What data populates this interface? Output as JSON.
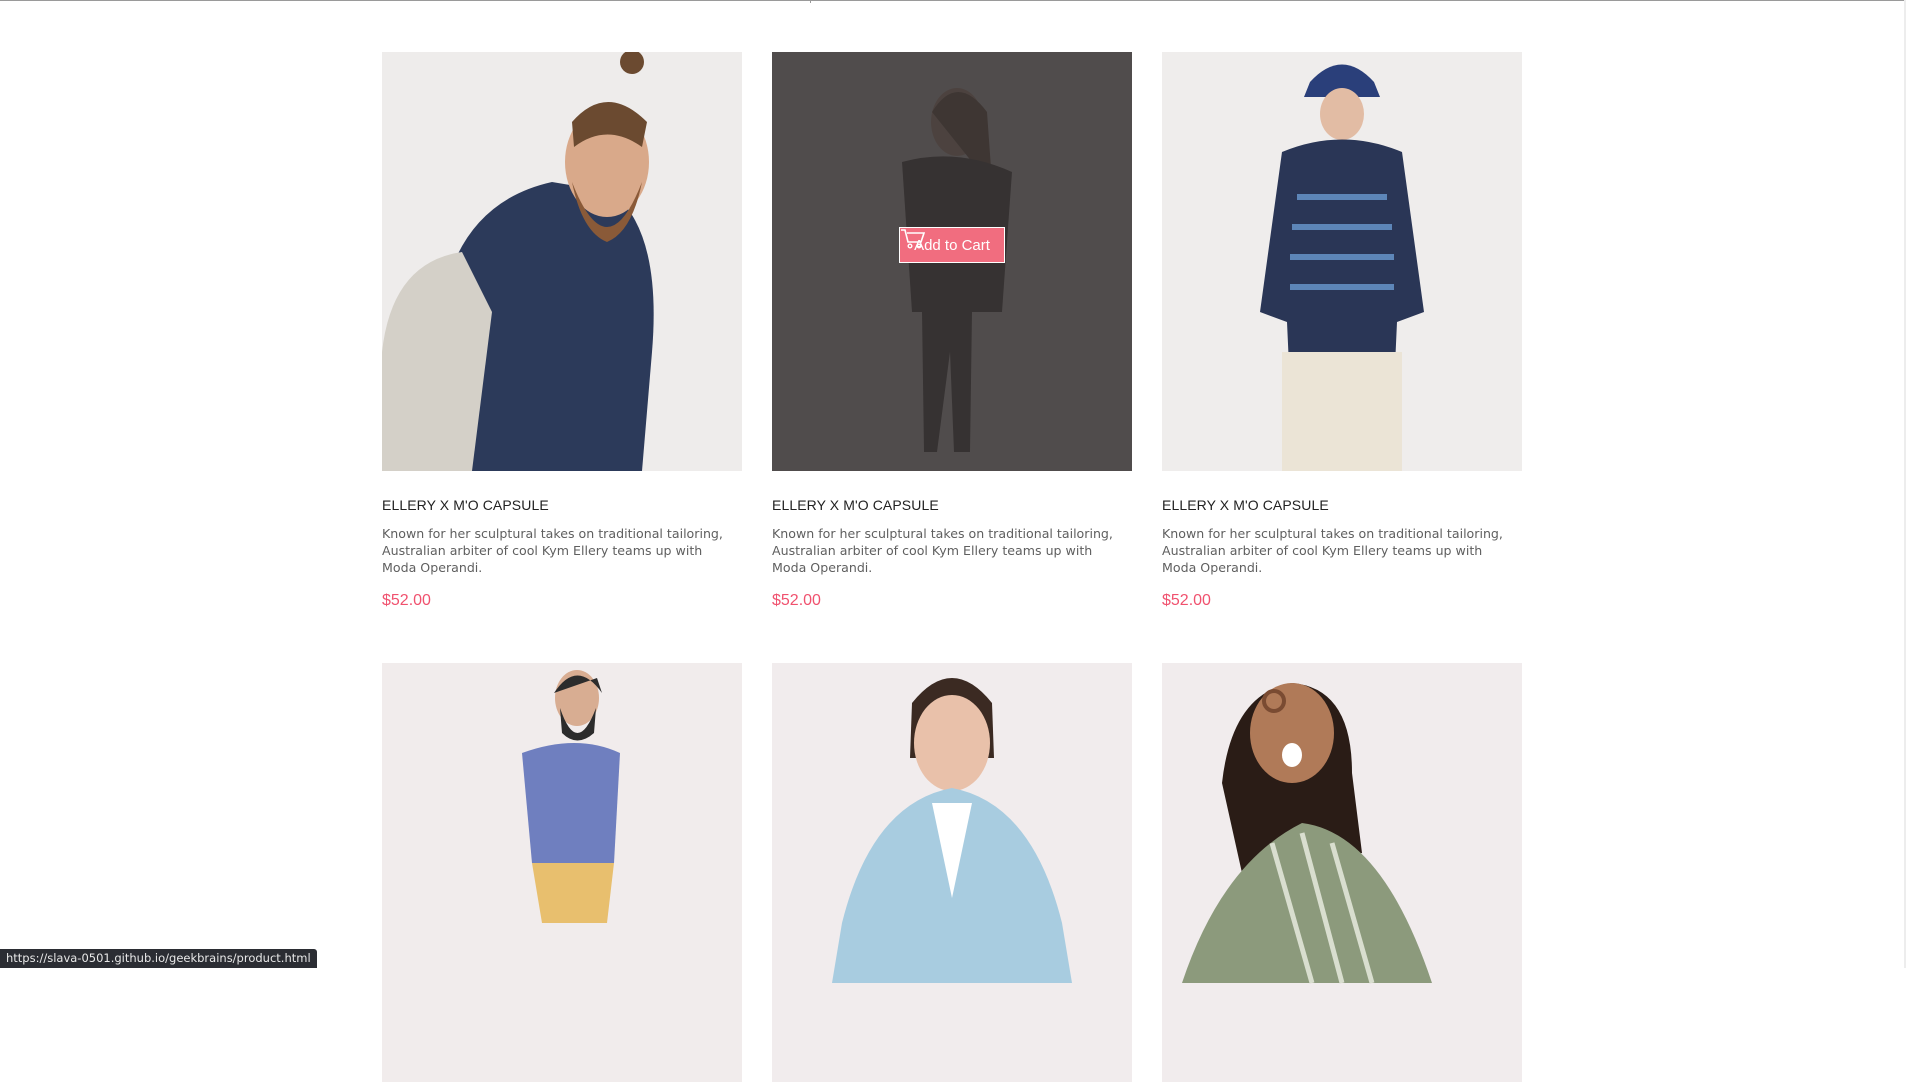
{
  "products": [
    {
      "title": "ELLERY X M'O CAPSULE",
      "description": "Known for her sculptural takes on traditional tailoring, Australian arbiter of cool Kym Ellery teams up with Moda Operandi.",
      "price": "$52.00"
    },
    {
      "title": "ELLERY X M'O CAPSULE",
      "description": "Known for her sculptural takes on traditional tailoring, Australian arbiter of cool Kym Ellery teams up with Moda Operandi.",
      "price": "$52.00",
      "hovered": true
    },
    {
      "title": "ELLERY X M'O CAPSULE",
      "description": "Known for her sculptural takes on traditional tailoring, Australian arbiter of cool Kym Ellery teams up with Moda Operandi.",
      "price": "$52.00"
    },
    {
      "title": "",
      "description": "",
      "price": ""
    },
    {
      "title": "",
      "description": "",
      "price": ""
    },
    {
      "title": "",
      "description": "",
      "price": ""
    }
  ],
  "add_to_cart": {
    "label": "Add to Cart",
    "icon": "cart-icon"
  },
  "status_bar": {
    "url": "https://slava-0501.github.io/geekbrains/product.html"
  },
  "colors": {
    "accent": "#f16d7f",
    "price": "#f0516e",
    "overlay": "#3a3536"
  }
}
